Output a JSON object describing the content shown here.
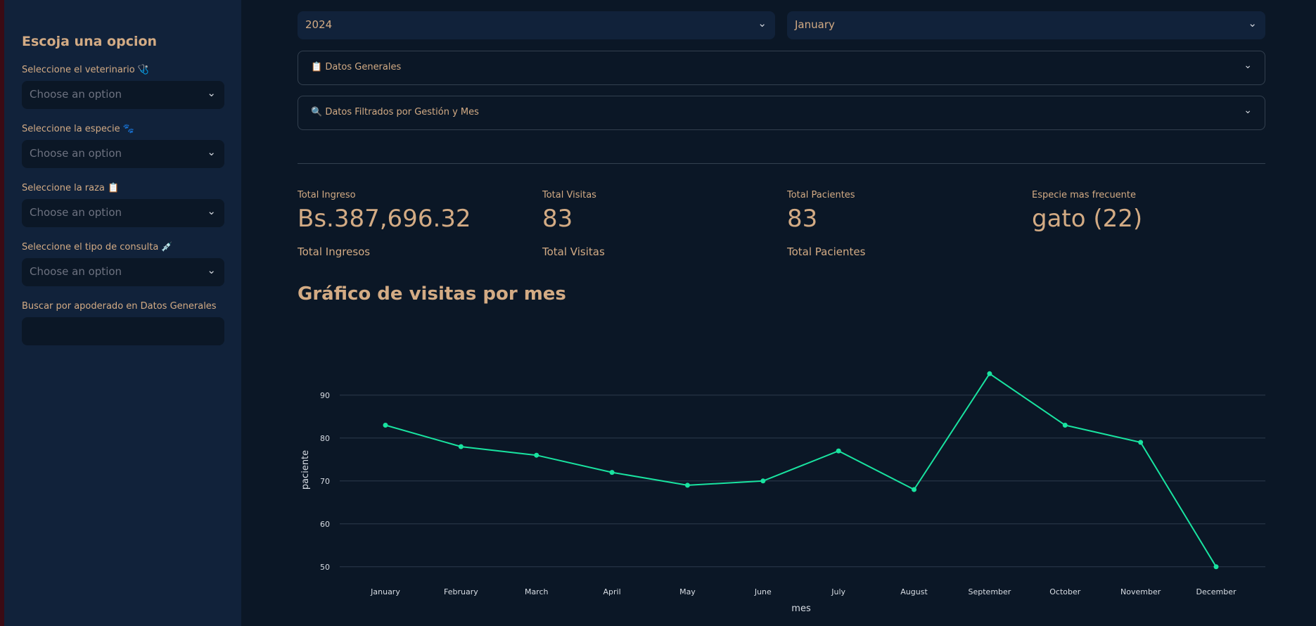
{
  "sidebar": {
    "title": "Escoja una opcion",
    "fields": [
      {
        "label": "Seleccione el veterinario 🩺",
        "placeholder": "Choose an option"
      },
      {
        "label": "Seleccione la especie 🐾",
        "placeholder": "Choose an option"
      },
      {
        "label": "Seleccione la raza 📋",
        "placeholder": "Choose an option"
      },
      {
        "label": "Seleccione el tipo de consulta 💉",
        "placeholder": "Choose an option"
      }
    ],
    "search": {
      "label": "Buscar por apoderado en Datos Generales",
      "value": ""
    }
  },
  "filters": {
    "year": "2024",
    "month": "January"
  },
  "expanders": [
    {
      "label": "📋 Datos Generales"
    },
    {
      "label": "🔍 Datos Filtrados por Gestión y Mes"
    }
  ],
  "metrics": [
    {
      "label": "Total Ingreso",
      "value": "Bs.387,696.32",
      "delta": "Total Ingresos"
    },
    {
      "label": "Total Visitas",
      "value": "83",
      "delta": "Total Visitas"
    },
    {
      "label": "Total Pacientes",
      "value": "83",
      "delta": "Total Pacientes"
    },
    {
      "label": "Especie mas frecuente",
      "value": "gato (22)",
      "delta": ""
    }
  ],
  "chart_title": "Gráfico de visitas por mes",
  "colors": {
    "line": "#19e3a0",
    "accent_text": "#d3ab84",
    "background": "#0b1726",
    "sidebar": "#11223a"
  },
  "chart_data": {
    "type": "line",
    "categories": [
      "January",
      "February",
      "March",
      "April",
      "May",
      "June",
      "July",
      "August",
      "September",
      "October",
      "November",
      "December"
    ],
    "series": [
      {
        "values": [
          83,
          78,
          76,
          72,
          69,
          70,
          77,
          68,
          95,
          83,
          79,
          50
        ]
      }
    ],
    "xlabel": "mes",
    "ylabel": "paciente",
    "yticks": [
      50,
      60,
      70,
      80,
      90
    ],
    "ylim": [
      48,
      98
    ],
    "grid": true
  }
}
